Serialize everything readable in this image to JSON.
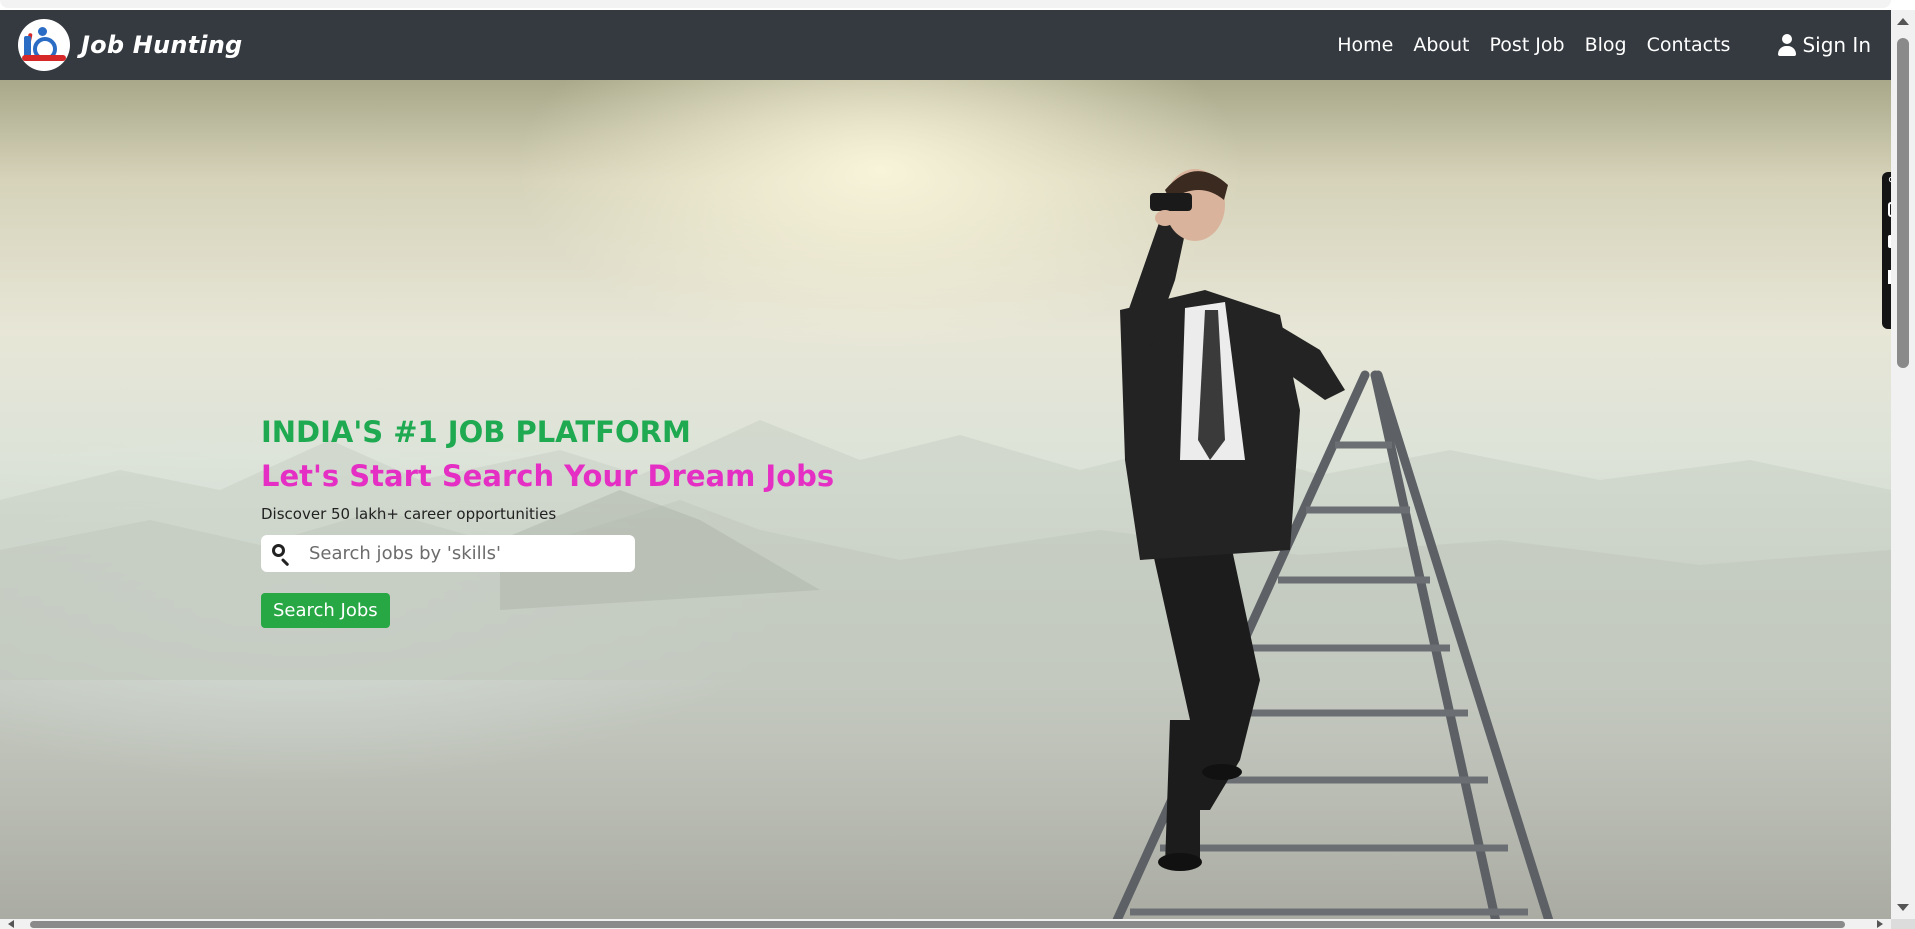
{
  "brand": {
    "name": "Job Hunting",
    "logo_icon": "job-hunting-logo-icon"
  },
  "nav": {
    "items": [
      {
        "label": "Home"
      },
      {
        "label": "About"
      },
      {
        "label": "Post Job"
      },
      {
        "label": "Blog"
      },
      {
        "label": "Contacts"
      }
    ],
    "signin": {
      "label": "Sign In",
      "icon": "user-icon"
    }
  },
  "hero": {
    "tagline": "INDIA'S #1 JOB PLATFORM",
    "headline": "Let's Start Search Your Dream Jobs",
    "subtitle": "Discover 50 lakh+ career opportunities",
    "search": {
      "placeholder": "Search jobs by 'skills'",
      "value": "",
      "icon": "search-icon"
    },
    "button_label": "Search Jobs"
  },
  "side_toolbar": {
    "icons": [
      "extension-icon",
      "camera-icon",
      "video-camera-icon",
      "windows-icon",
      "gear-icon"
    ]
  },
  "colors": {
    "navbar_bg": "#343a40",
    "tagline": "#1faa52",
    "headline": "#e52fc4",
    "button_bg": "#28a745",
    "text_light": "#ffffff"
  }
}
